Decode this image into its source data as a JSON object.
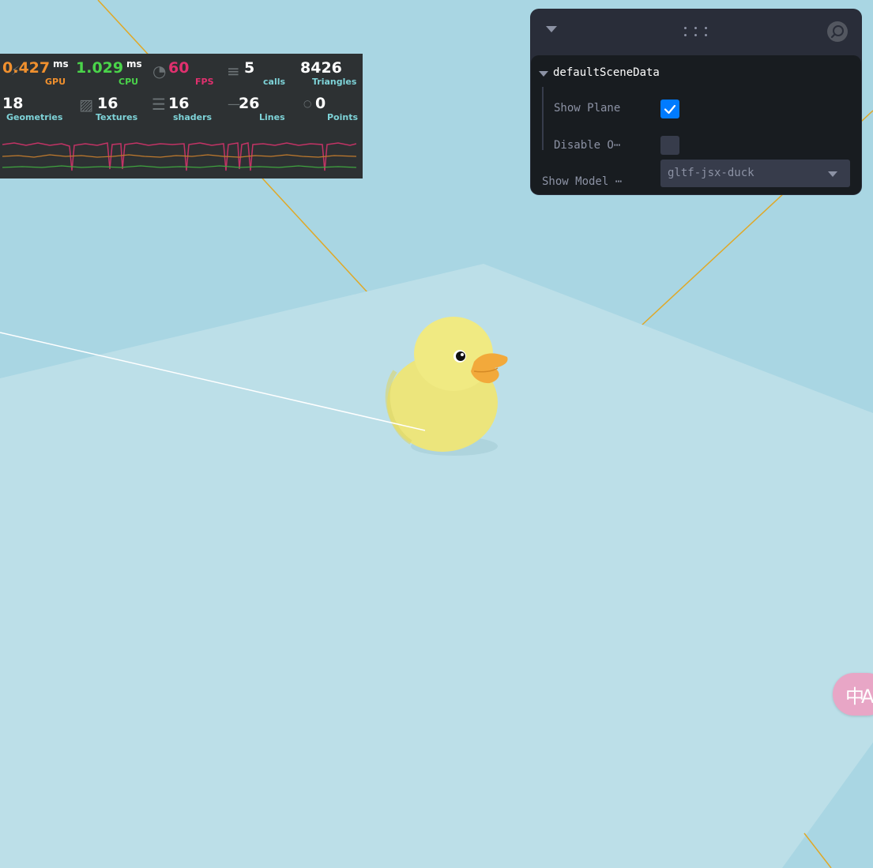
{
  "colors": {
    "background": "#a9d6e3",
    "plane": "#bcdfe8",
    "grid_line": "#e0a826",
    "gpu": "#f0902e",
    "cpu": "#4ad44a",
    "fps": "#e0306e",
    "stat_label": "#7ed3d8",
    "panel_bg": "#292d39",
    "panel_body": "#181c20",
    "accent": "#007bff",
    "duck": "#ece57c",
    "beak": "#f2a93b"
  },
  "perf_monitor": {
    "gpu": {
      "value": "0.427",
      "unit": "ms",
      "label": "GPU"
    },
    "cpu": {
      "value": "1.029",
      "unit": "ms",
      "label": "CPU"
    },
    "fps": {
      "value": "60",
      "label": "FPS"
    },
    "calls": {
      "value": "5",
      "label": "calls"
    },
    "triangles": {
      "value": "8426",
      "label": "Triangles"
    },
    "geometries": {
      "value": "18",
      "label": "Geometries"
    },
    "textures": {
      "value": "16",
      "label": "Textures"
    },
    "shaders": {
      "value": "16",
      "label": "shaders"
    },
    "lines": {
      "value": "26",
      "label": "Lines"
    },
    "points": {
      "value": "0",
      "label": "Points"
    }
  },
  "controls_panel": {
    "folder_title": "defaultSceneData",
    "show_plane": {
      "label": "Show Plane",
      "checked": true
    },
    "disable": {
      "label": "Disable O⋯",
      "checked": false
    },
    "show_model": {
      "label": "Show Model ⋯",
      "selected": "gltf-jsx-duck"
    },
    "icons": {
      "collapse": "chevron-down-icon",
      "drag": "drag-handle-icon",
      "search": "search-icon"
    }
  },
  "translate_button": {
    "label": "中A",
    "icon": "translate-icon"
  }
}
